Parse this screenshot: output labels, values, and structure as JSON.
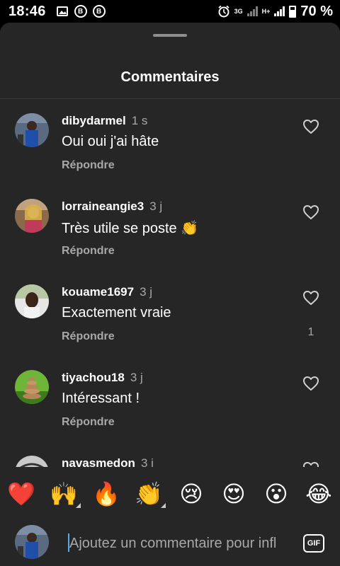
{
  "status_bar": {
    "time": "18:46",
    "network": "3G",
    "network2": "H+",
    "battery": "70 %"
  },
  "sheet": {
    "title": "Commentaires"
  },
  "comments": [
    {
      "username": "dibydarmel",
      "time": "1 s",
      "text": "Oui oui j'ai hâte",
      "reply": "Répondre",
      "likes": ""
    },
    {
      "username": "lorraineangie3",
      "time": "3 j",
      "text": "Très utile se poste 👏",
      "reply": "Répondre",
      "likes": ""
    },
    {
      "username": "kouame1697",
      "time": "3 j",
      "text": "Exactement vraie",
      "reply": "Répondre",
      "likes": "1"
    },
    {
      "username": "tiyachou18",
      "time": "3 j",
      "text": "Intéressant !",
      "reply": "Répondre",
      "likes": ""
    },
    {
      "username": "navasmedon",
      "time": "3 j",
      "text": "",
      "reply": "",
      "likes": ""
    }
  ],
  "emoji_bar": [
    "❤️",
    "🙌",
    "🔥",
    "👏",
    "😢",
    "😍",
    "😮",
    "😂"
  ],
  "input": {
    "placeholder": "Ajoutez un commentaire pour infl",
    "gif_label": "GIF"
  },
  "colors": {
    "background": "#262626",
    "secondary_text": "#a8a8a8",
    "caret": "#5aa9e6"
  }
}
